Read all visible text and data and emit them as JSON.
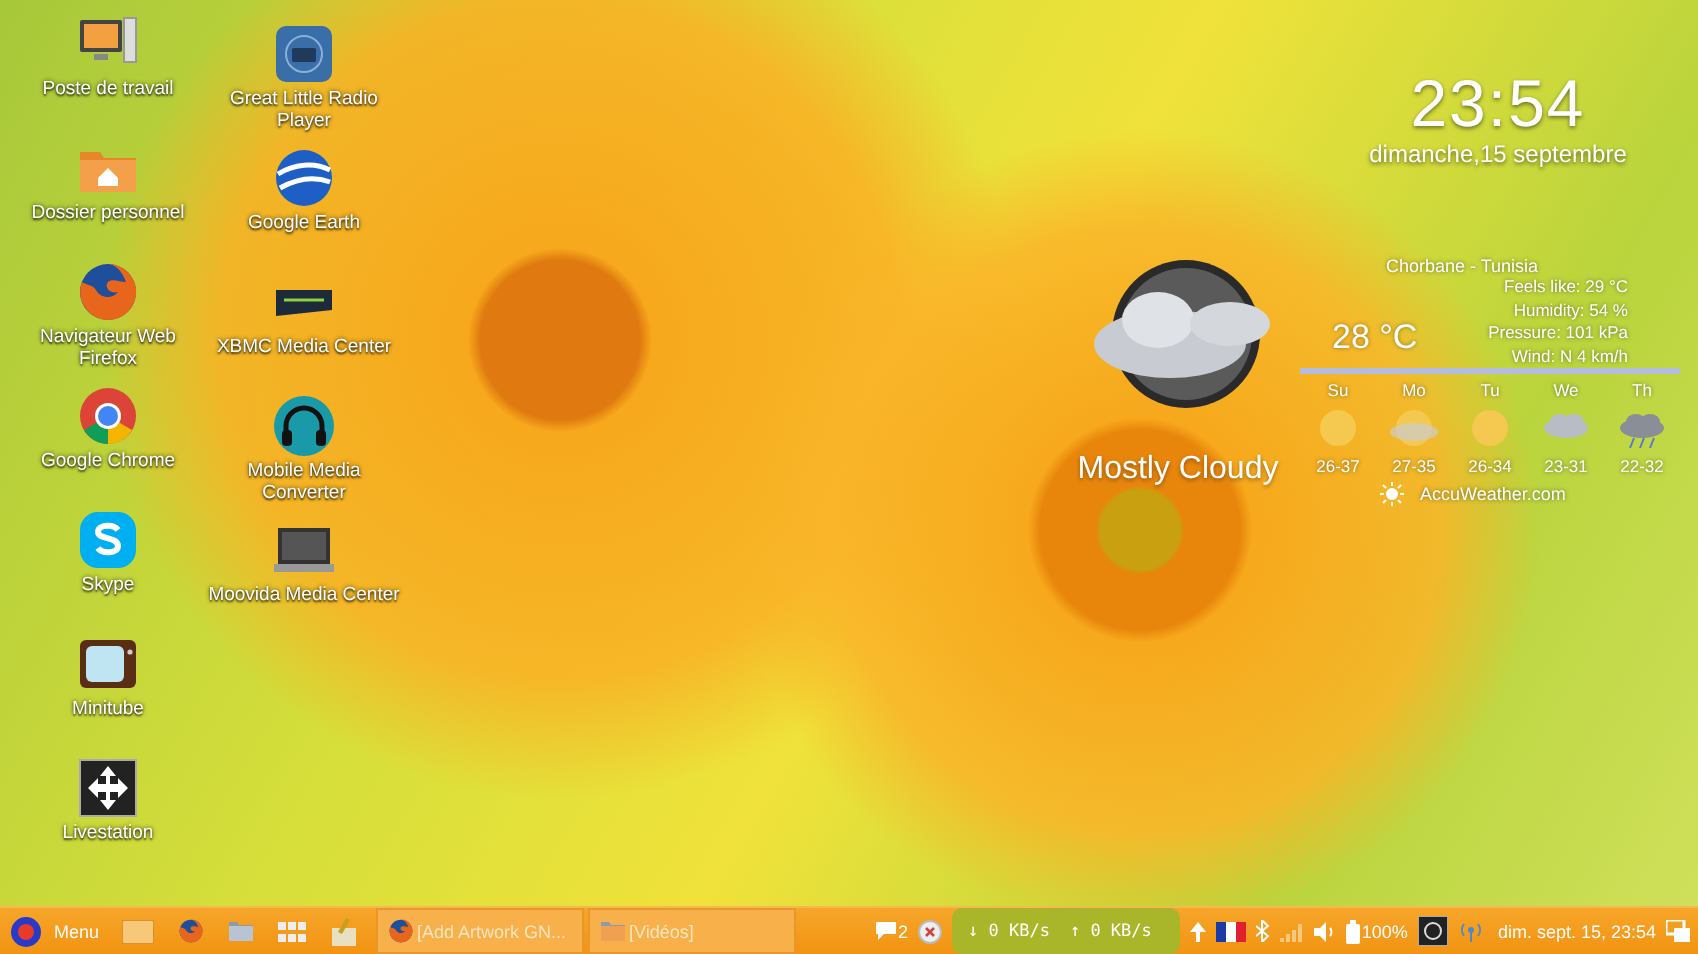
{
  "desktop_columns": [
    {
      "icons": [
        {
          "label": "Poste de travail",
          "kind": "computer"
        },
        {
          "label": "Dossier personnel",
          "kind": "home-folder"
        },
        {
          "label": "Navigateur Web Firefox",
          "kind": "firefox"
        },
        {
          "label": "Google Chrome",
          "kind": "chrome"
        },
        {
          "label": "Skype",
          "kind": "skype"
        },
        {
          "label": "Minitube",
          "kind": "tv"
        },
        {
          "label": "Livestation",
          "kind": "move"
        }
      ]
    },
    {
      "icons": [
        {
          "label": "Great Little Radio Player",
          "kind": "radio"
        },
        {
          "label": "Google Earth",
          "kind": "globe"
        },
        {
          "label": "XBMC Media Center",
          "kind": "xbmc"
        },
        {
          "label": "Mobile Media Converter",
          "kind": "headphones"
        },
        {
          "label": "Moovida Media Center",
          "kind": "laptop"
        }
      ]
    }
  ],
  "clock": {
    "time": "23:54",
    "date": "dimanche,15 septembre"
  },
  "weather": {
    "condition": "Mostly Cloudy",
    "location": "Chorbane - Tunisia",
    "temperature": "28 °C",
    "details": [
      "Feels like: 29 °C",
      "Humidity: 54 %",
      "Pressure: 101 kPa",
      "Wind: N 4 km/h"
    ],
    "forecast": [
      {
        "day": "Su",
        "kind": "sunny",
        "range": "26-37"
      },
      {
        "day": "Mo",
        "kind": "hazy",
        "range": "27-35"
      },
      {
        "day": "Tu",
        "kind": "sunny",
        "range": "26-34"
      },
      {
        "day": "We",
        "kind": "cloudy",
        "range": "23-31"
      },
      {
        "day": "Th",
        "kind": "storm",
        "range": "22-32"
      }
    ],
    "source": "AccuWeather.com"
  },
  "taskbar": {
    "menu": "Menu",
    "launchers": [
      {
        "kind": "desktop"
      },
      {
        "kind": "firefox"
      },
      {
        "kind": "folder"
      },
      {
        "kind": "grid"
      },
      {
        "kind": "paint"
      }
    ],
    "tasks": [
      {
        "label": "[Add  Artwork GN...",
        "kind": "firefox"
      },
      {
        "label": "[Vidéos]",
        "kind": "folder"
      }
    ],
    "messages": "2",
    "down_speed": "↓ 0 KB/s",
    "up_speed": "↑ 0 KB/s",
    "battery": "100%",
    "datetime": "dim. sept. 15, 23:54"
  }
}
